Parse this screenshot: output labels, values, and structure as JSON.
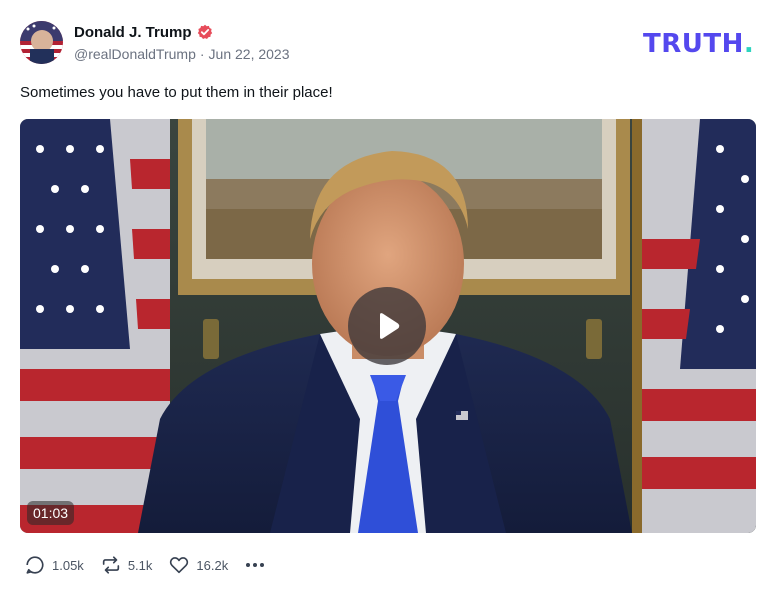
{
  "author": {
    "name": "Donald J. Trump",
    "handle": "@realDonaldTrump",
    "separator": "·",
    "date": "Jun 22, 2023"
  },
  "brand": {
    "logo_text": "TRUTH",
    "logo_dot": ".",
    "logo_color": "#5448ee",
    "dot_color": "#2dd4bf"
  },
  "post": {
    "text": "Sometimes you have to put them in their place!"
  },
  "video": {
    "duration": "01:03"
  },
  "actions": {
    "replies": "1.05k",
    "retruths": "5.1k",
    "likes": "16.2k"
  },
  "icons": {
    "verified": "verified-badge-icon",
    "reply": "reply-icon",
    "retruth": "retruth-icon",
    "like": "heart-icon",
    "more": "more-icon",
    "play": "play-icon"
  },
  "colors": {
    "verified_badge": "#e74c5a",
    "play_overlay": "#3c373a"
  }
}
